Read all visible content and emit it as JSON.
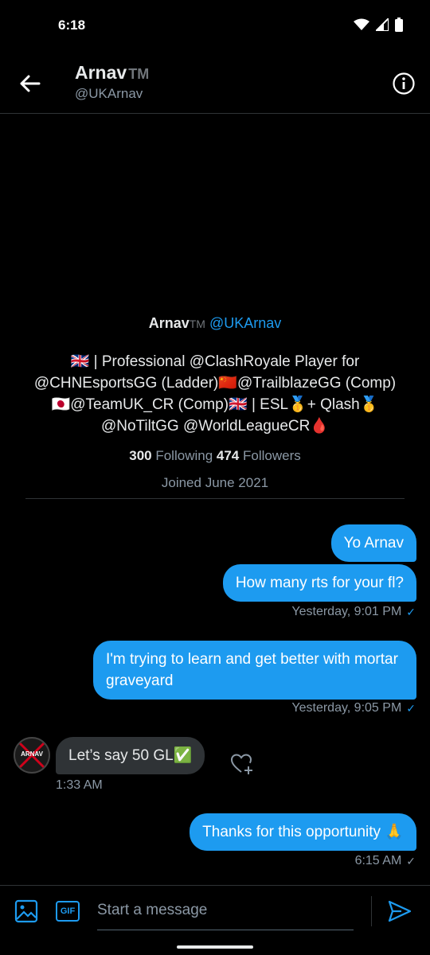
{
  "status": {
    "time": "6:18"
  },
  "header": {
    "name": "Arnav",
    "name_suffix": "TM",
    "handle": "@UKArnav"
  },
  "profile": {
    "name": "Arnav",
    "name_suffix": "TM",
    "handle": "@UKArnav",
    "bio_lines": [
      "🇬🇧 | Professional @ClashRoyale Player for",
      "@CHNEsportsGG (Ladder)🇨🇳@TrailblazeGG (Comp)",
      "🇯🇵@TeamUK_CR (Comp)🇬🇧 | ESL🥇+ Qlash🥇",
      "@NoTiltGG @WorldLeagueCR🩸"
    ],
    "following_count": "300",
    "following_label": "Following",
    "followers_count": "474",
    "followers_label": "Followers",
    "joined": "Joined June 2021"
  },
  "messages": [
    {
      "text": "Yo Arnav"
    },
    {
      "text": "How many rts for your fl?",
      "meta": "Yesterday, 9:01 PM"
    },
    {
      "text": "I'm trying to learn and get better with mortar graveyard",
      "meta": "Yesterday, 9:05 PM"
    },
    {
      "text": "Let’s say 50 GL✅",
      "meta": "1:33 AM"
    },
    {
      "text": "Thanks for this opportunity 🙏",
      "meta": "6:15 AM"
    }
  ],
  "avatar_text": "ARNAV",
  "composer": {
    "gif_label": "GIF",
    "placeholder": "Start a message"
  },
  "colors": {
    "accent": "#1d9bf0",
    "background": "#000000",
    "bubble_in": "#2f3336"
  }
}
